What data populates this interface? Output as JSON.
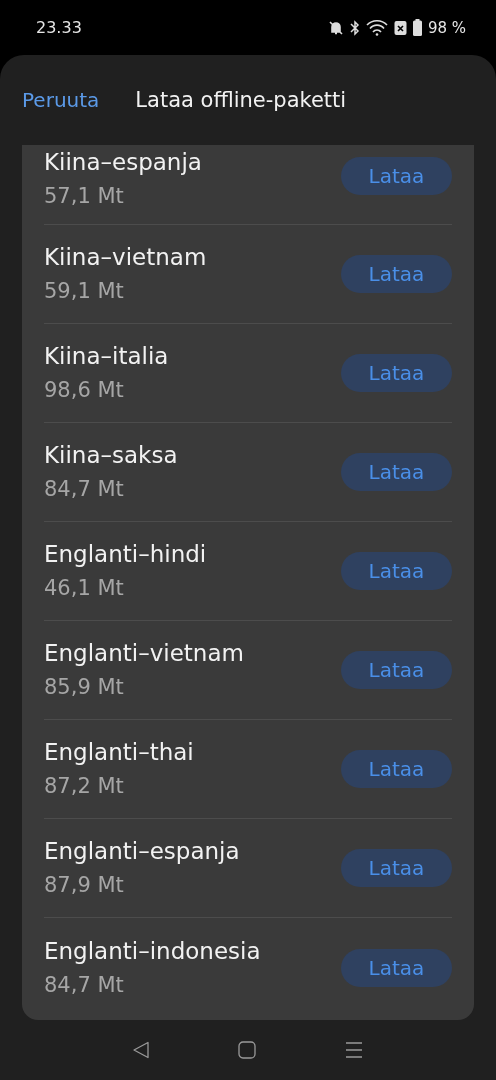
{
  "status_bar": {
    "time": "23.33",
    "battery": "98 %"
  },
  "header": {
    "cancel": "Peruuta",
    "title": "Lataa offline-paketti"
  },
  "packages": [
    {
      "name": "Kiina–espanja",
      "size": "57,1 Mt",
      "button": "Lataa"
    },
    {
      "name": "Kiina–vietnam",
      "size": "59,1 Mt",
      "button": "Lataa"
    },
    {
      "name": "Kiina–italia",
      "size": "98,6 Mt",
      "button": "Lataa"
    },
    {
      "name": "Kiina–saksa",
      "size": "84,7 Mt",
      "button": "Lataa"
    },
    {
      "name": "Englanti–hindi",
      "size": "46,1 Mt",
      "button": "Lataa"
    },
    {
      "name": "Englanti–vietnam",
      "size": "85,9 Mt",
      "button": "Lataa"
    },
    {
      "name": "Englanti–thai",
      "size": "87,2 Mt",
      "button": "Lataa"
    },
    {
      "name": "Englanti–espanja",
      "size": "87,9 Mt",
      "button": "Lataa"
    },
    {
      "name": "Englanti–indonesia",
      "size": "84,7 Mt",
      "button": "Lataa"
    }
  ]
}
